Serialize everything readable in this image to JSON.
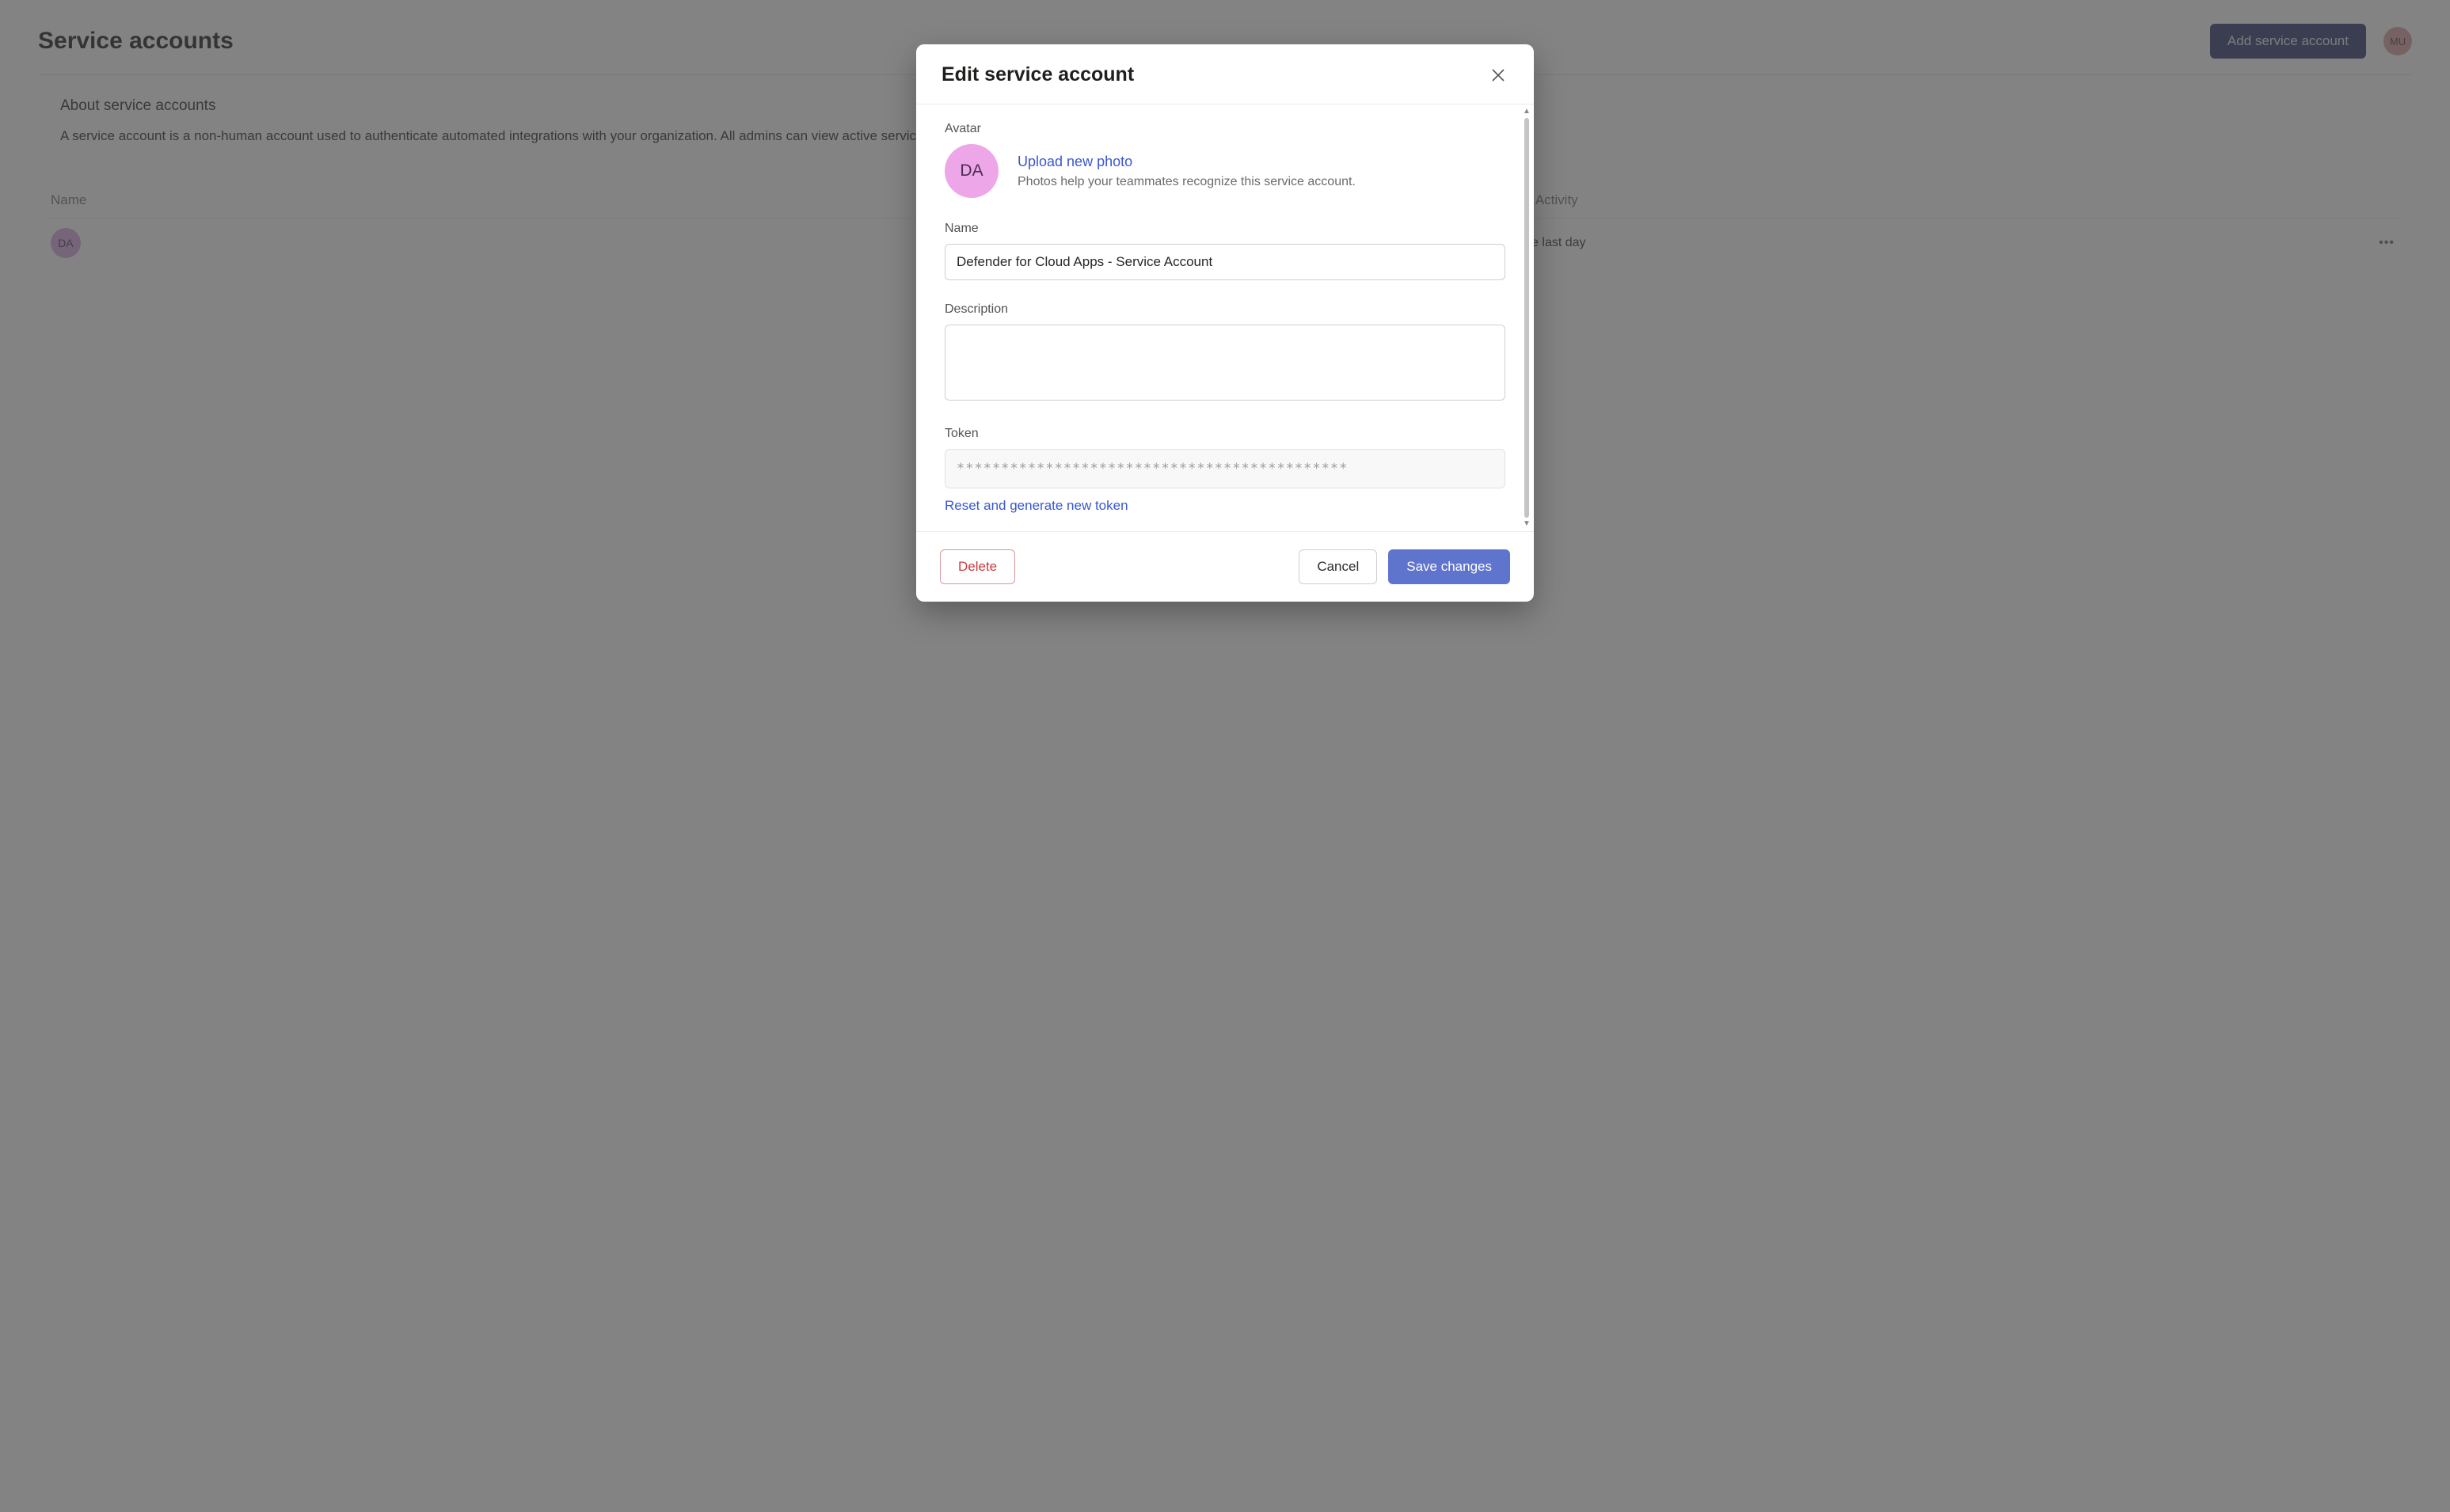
{
  "page": {
    "title": "Service accounts",
    "add_button": "Add service account",
    "user_initials": "MU",
    "about_heading": "About service accounts",
    "about_text": "A service account is a non-human account used to authenticate automated integrations with your organization. All admins can view active service accounts and revoke their access."
  },
  "table": {
    "headers": {
      "name": "Name",
      "activity": "Last Activity"
    },
    "rows": [
      {
        "avatar_text": "DA",
        "activity": "In the last day"
      }
    ]
  },
  "modal": {
    "title": "Edit service account",
    "avatar_label": "Avatar",
    "avatar_initials": "DA",
    "upload_label": "Upload new photo",
    "upload_help": "Photos help your teammates recognize this service account.",
    "name_label": "Name",
    "name_value": "Defender for Cloud Apps - Service Account",
    "desc_label": "Description",
    "desc_value": "",
    "token_label": "Token",
    "token_value": "********************************************",
    "reset_label": "Reset and generate new token",
    "delete_label": "Delete",
    "cancel_label": "Cancel",
    "save_label": "Save changes"
  }
}
